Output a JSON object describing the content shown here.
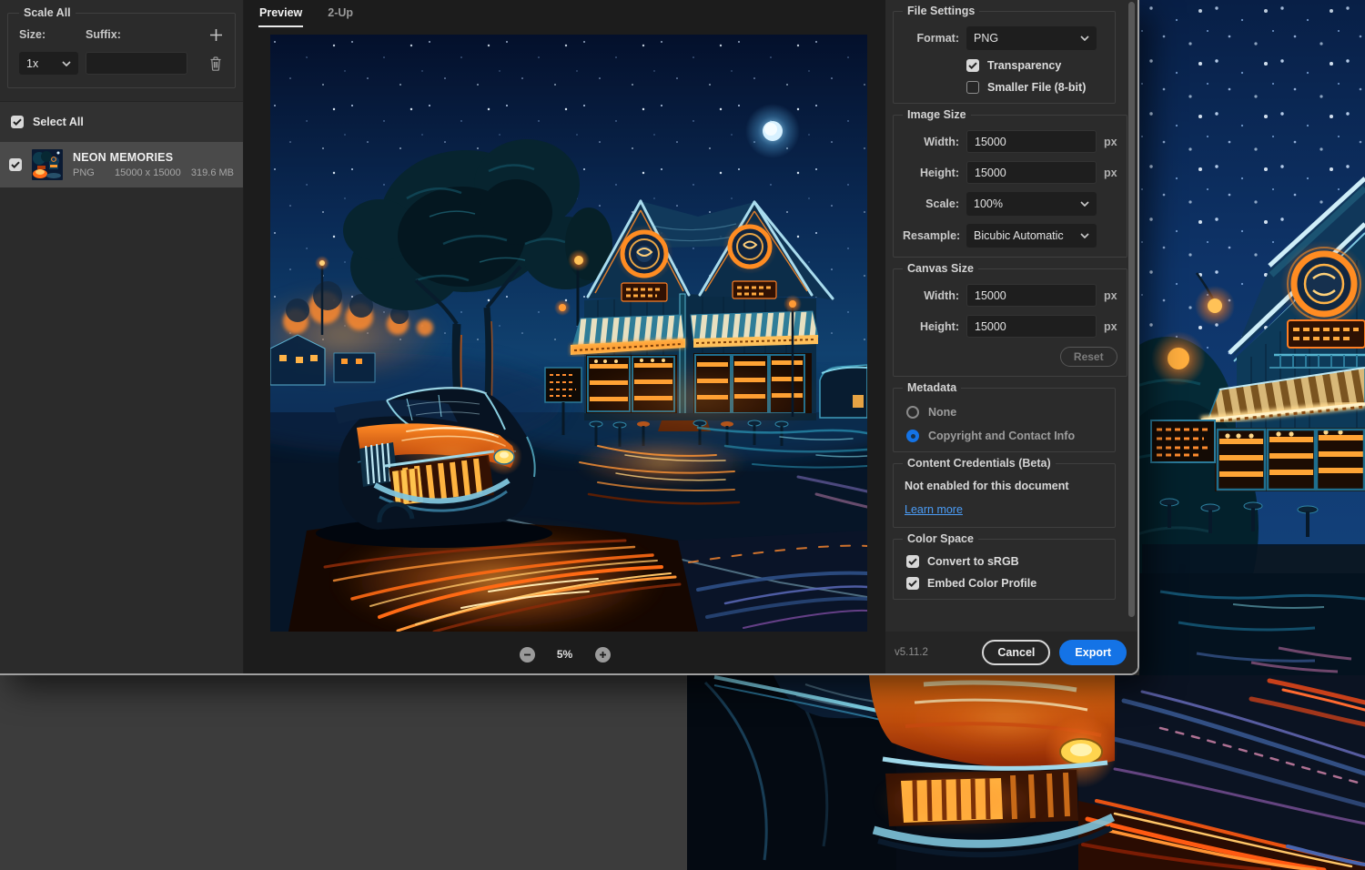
{
  "left_panel": {
    "scale_all": {
      "title": "Scale All",
      "size_label": "Size:",
      "suffix_label": "Suffix:",
      "size_value": "1x",
      "suffix_value": ""
    },
    "select_all_label": "Select All",
    "files": [
      {
        "name": "NEON MEMORIES",
        "format": "PNG",
        "dimensions": "15000 x 15000",
        "file_size": "319.6 MB",
        "selected": true
      }
    ]
  },
  "preview": {
    "tabs": [
      {
        "label": "Preview",
        "active": true
      },
      {
        "label": "2-Up",
        "active": false
      }
    ],
    "zoom_level": "5%"
  },
  "file_settings": {
    "title": "File Settings",
    "format_label": "Format:",
    "format_value": "PNG",
    "transparency": {
      "label": "Transparency",
      "checked": true
    },
    "smaller_file": {
      "label": "Smaller File (8-bit)",
      "checked": false
    }
  },
  "image_size": {
    "title": "Image Size",
    "width_label": "Width:",
    "width_value": "15000",
    "height_label": "Height:",
    "height_value": "15000",
    "unit": "px",
    "scale_label": "Scale:",
    "scale_value": "100%",
    "resample_label": "Resample:",
    "resample_value": "Bicubic Automatic"
  },
  "canvas_size": {
    "title": "Canvas Size",
    "width_label": "Width:",
    "width_value": "15000",
    "height_label": "Height:",
    "height_value": "15000",
    "unit": "px",
    "reset_label": "Reset"
  },
  "metadata": {
    "title": "Metadata",
    "options": [
      {
        "label": "None",
        "selected": false
      },
      {
        "label": "Copyright and Contact Info",
        "selected": true
      }
    ]
  },
  "content_credentials": {
    "title": "Content Credentials (Beta)",
    "status": "Not enabled for this document",
    "link_label": "Learn more"
  },
  "color_space": {
    "title": "Color Space",
    "options": [
      {
        "label": "Convert to sRGB",
        "checked": true
      },
      {
        "label": "Embed Color Profile",
        "checked": true
      }
    ]
  },
  "footer": {
    "version": "v5.11.2",
    "cancel_label": "Cancel",
    "export_label": "Export"
  },
  "colors": {
    "accent_blue": "#1473E6",
    "link_blue": "#4B9CF5",
    "selection_gray": "#4A4A4A"
  }
}
